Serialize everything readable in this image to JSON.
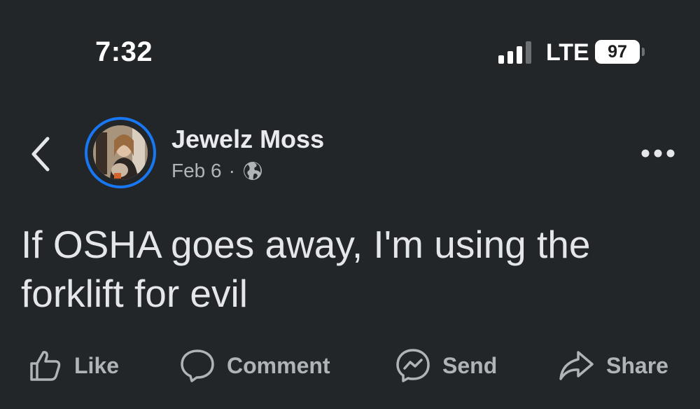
{
  "status_bar": {
    "time": "7:32",
    "network": "LTE",
    "battery": "97"
  },
  "post": {
    "author": "Jewelz Moss",
    "date": "Feb 6",
    "separator": "·",
    "text_line1": "If OSHA goes away, I'm using the",
    "text_line2": "forklift for evil"
  },
  "actions": {
    "like": "Like",
    "comment": "Comment",
    "send": "Send",
    "share": "Share"
  },
  "colors": {
    "background": "#232628",
    "story_ring": "#1877f2",
    "secondary_text": "#b0b3b8"
  }
}
